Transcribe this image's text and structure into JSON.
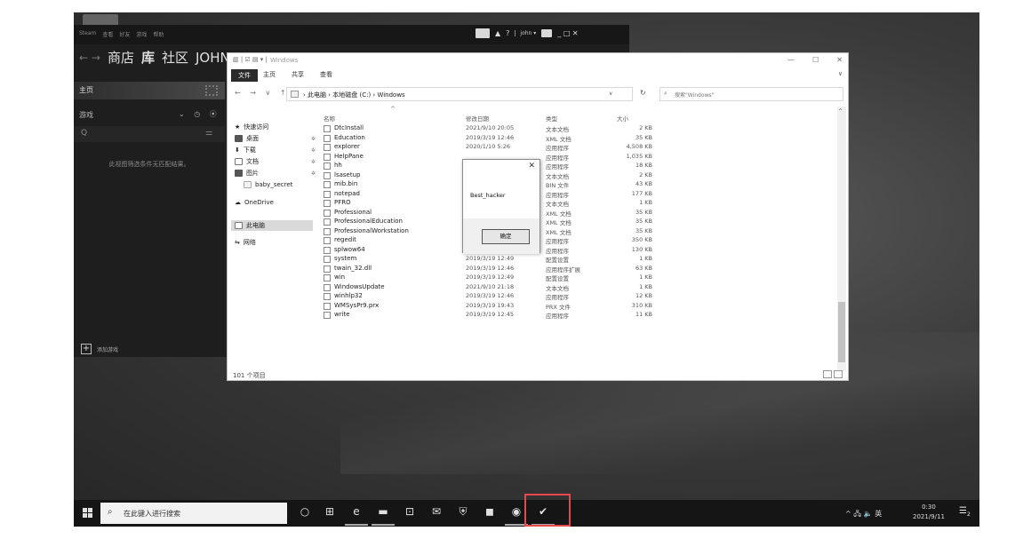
{
  "steam": {
    "menu": [
      "Steam",
      "查看",
      "好友",
      "游戏",
      "帮助"
    ],
    "user": "john ▾",
    "window_controls": "_ □ ✕",
    "nav_arrows": "← →",
    "nav": [
      "商店",
      "库",
      "社区",
      "JOHN"
    ],
    "home": "主页",
    "games_label": "游戏",
    "games_controls": "⌄ ◷ ⦿",
    "search_icon": "Q",
    "filter_icon": "⚌",
    "no_match": "此视图筛选条件无匹配结果。",
    "add_game": "添加游戏"
  },
  "explorer": {
    "quick_access": "▥ | ☑ ▤ ▾ |",
    "title": "Windows",
    "window_controls": [
      "—",
      "☐",
      "✕"
    ],
    "ribbon_tabs": [
      "文件",
      "主页",
      "共享",
      "查看"
    ],
    "ribbon_chevron": "∨",
    "nav_buttons": "← → ∨ ↑",
    "breadcrumb": "›  此电脑  ›  本地磁盘 (C:)  ›  Windows",
    "address_dropdown": "∨",
    "refresh": "↻",
    "search_icon": "⌕",
    "search_placeholder": "搜索\"Windows\"",
    "nav_items": [
      "快速访问",
      "桌面",
      "下载",
      "文档",
      "图片",
      "baby_secret",
      "OneDrive",
      "此电脑",
      "网络"
    ],
    "pin": "✲",
    "sort_arrow": "^",
    "columns": [
      "名称",
      "修改日期",
      "类型",
      "大小"
    ],
    "scroll_up": "^",
    "files": [
      {
        "name": "DtcInstall",
        "date": "2021/9/10 20:05",
        "type": "文本文档",
        "size": "2 KB"
      },
      {
        "name": "Education",
        "date": "2019/3/19 12:46",
        "type": "XML 文档",
        "size": "35 KB"
      },
      {
        "name": "explorer",
        "date": "2020/1/10 5:26",
        "type": "应用程序",
        "size": "4,508 KB"
      },
      {
        "name": "HelpPane",
        "date": "",
        "type": "应用程序",
        "size": "1,035 KB"
      },
      {
        "name": "hh",
        "date": "",
        "type": "应用程序",
        "size": "18 KB"
      },
      {
        "name": "lsasetup",
        "date": "",
        "type": "文本文档",
        "size": "2 KB"
      },
      {
        "name": "mib.bin",
        "date": "",
        "type": "BIN 文件",
        "size": "43 KB"
      },
      {
        "name": "notepad",
        "date": "",
        "type": "应用程序",
        "size": "177 KB"
      },
      {
        "name": "PFRO",
        "date": "",
        "type": "文本文档",
        "size": "1 KB"
      },
      {
        "name": "Professional",
        "date": "",
        "type": "XML 文档",
        "size": "35 KB"
      },
      {
        "name": "ProfessionalEducation",
        "date": "2019/3/19 12:46",
        "type": "XML 文档",
        "size": "35 KB"
      },
      {
        "name": "ProfessionalWorkstation",
        "date": "2019/3/19 12:46",
        "type": "XML 文档",
        "size": "35 KB"
      },
      {
        "name": "regedit",
        "date": "2019/3/19 12:45",
        "type": "应用程序",
        "size": "350 KB"
      },
      {
        "name": "splwow64",
        "date": "2020/1/10 5:26",
        "type": "应用程序",
        "size": "130 KB"
      },
      {
        "name": "system",
        "date": "2019/3/19 12:49",
        "type": "配置设置",
        "size": "1 KB"
      },
      {
        "name": "twain_32.dll",
        "date": "2019/3/19 12:46",
        "type": "应用程序扩展",
        "size": "63 KB"
      },
      {
        "name": "win",
        "date": "2019/3/19 12:49",
        "type": "配置设置",
        "size": "1 KB"
      },
      {
        "name": "WindowsUpdate",
        "date": "2021/9/10 21:18",
        "type": "文本文档",
        "size": "1 KB"
      },
      {
        "name": "winhlp32",
        "date": "2019/3/19 12:46",
        "type": "应用程序",
        "size": "12 KB"
      },
      {
        "name": "WMSysPr9.prx",
        "date": "2019/3/19 19:43",
        "type": "PRX 文件",
        "size": "310 KB"
      },
      {
        "name": "write",
        "date": "2019/3/19 12:45",
        "type": "应用程序",
        "size": "11 KB"
      }
    ],
    "status": "101 个项目"
  },
  "msgbox": {
    "close": "✕",
    "message": "Best_hacker",
    "ok": "确定"
  },
  "taskbar": {
    "search_icon": "⌕",
    "search_placeholder": "在此键入进行搜索",
    "tray": "^ 🖧 🔈 英",
    "time": "0:30",
    "date": "2021/9/11",
    "notification_icon": "☰",
    "notification_count": "2"
  }
}
